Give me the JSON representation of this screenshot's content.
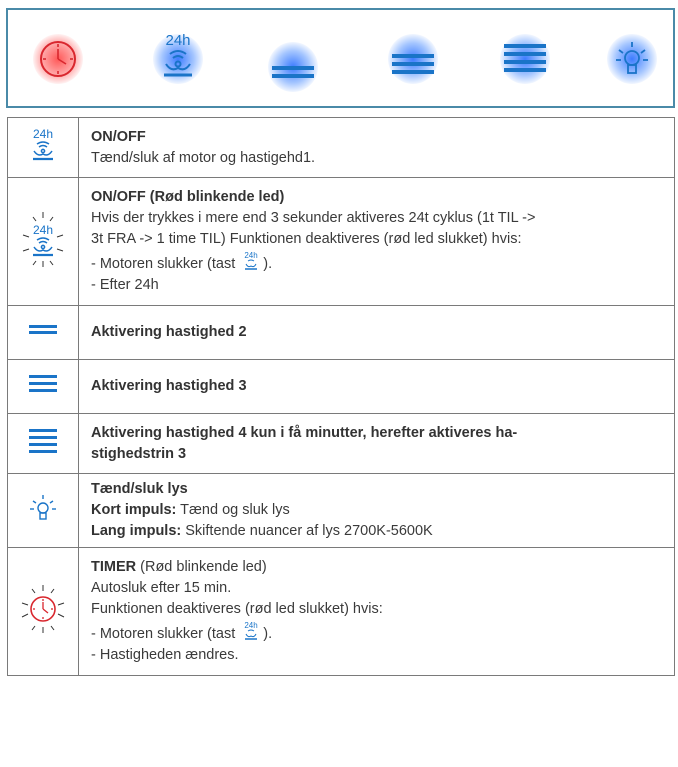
{
  "panel": {
    "buttons": [
      {
        "icon": "timer-icon",
        "glow": "red"
      },
      {
        "icon": "fan-24h-icon",
        "label": "24h",
        "glow": "blue"
      },
      {
        "icon": "speed-2-icon",
        "glow": "blue"
      },
      {
        "icon": "speed-3-icon",
        "glow": "blue"
      },
      {
        "icon": "speed-4-icon",
        "glow": "blue"
      },
      {
        "icon": "light-icon",
        "glow": "blue"
      }
    ]
  },
  "colors": {
    "accent_blue": "#1a74c8",
    "timer_red": "#d9272e",
    "frame": "#4a8aa8"
  },
  "rows": [
    {
      "icon": "fan-24h-icon",
      "icon_label": "24h",
      "title": "ON/OFF",
      "lines": [
        "Tænd/sluk af motor og hastigehd1."
      ]
    },
    {
      "icon": "fan-24h-blinking-icon",
      "icon_label": "24h",
      "title": "ON/OFF (Rød blinkende led)",
      "lines": [
        "Hvis der trykkes i mere end 3 sekunder aktiveres 24t cyklus (1t TIL ->",
        "3t FRA -> 1 time TIL) Funktionen deaktiveres (rød led slukket) hvis:"
      ],
      "bullet1_pre": "- Motoren slukker (tast ",
      "bullet1_icon_label": "24h",
      "bullet1_post": ").",
      "bullet2": "- Efter 24h"
    },
    {
      "icon": "speed-2-icon",
      "title": "Aktivering hastighed 2"
    },
    {
      "icon": "speed-3-icon",
      "title": "Aktivering hastighed 3"
    },
    {
      "icon": "speed-4-icon",
      "title_lines": [
        "Aktivering hastighed 4 kun i få minutter, herefter aktiveres ha-",
        "stighedstrin 3"
      ]
    },
    {
      "icon": "light-icon",
      "title": "Tænd/sluk lys",
      "short_label": "Kort impuls:",
      "short_text": " Tænd og sluk lys",
      "long_label": "Lang impuls:",
      "long_text": " Skiftende nuancer af lys 2700K-5600K"
    },
    {
      "icon": "timer-blinking-icon",
      "title": "TIMER",
      "title_suffix": " (Rød blinkende led)",
      "lines": [
        "Autosluk efter 15 min.",
        "Funktionen deaktiveres (rød led slukket) hvis:"
      ],
      "bullet1_pre": "- Motoren slukker (tast ",
      "bullet1_icon_label": "24h",
      "bullet1_post": ").",
      "bullet2": "- Hastigheden ændres."
    }
  ]
}
